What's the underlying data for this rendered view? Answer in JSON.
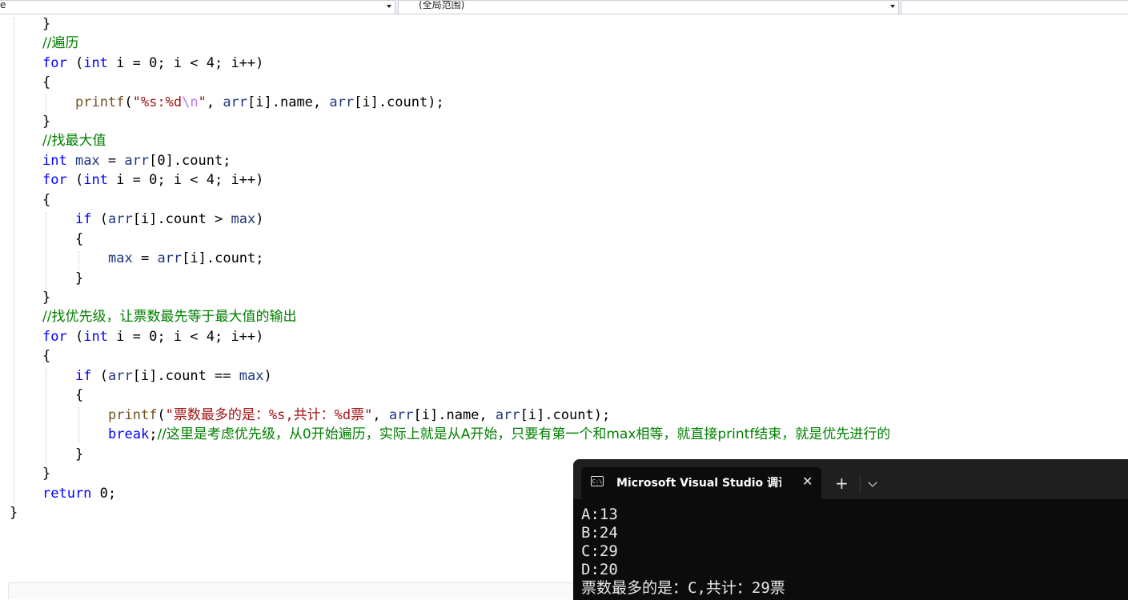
{
  "navbar": {
    "left_combo": "e",
    "right_combo": "(全局范围)"
  },
  "code": {
    "l01": "}",
    "l02_comment": "//遍历",
    "for_kw": "for",
    "int_kw": "int",
    "loop_rest_a": " i = 0; i < 4; i++)",
    "open_brace": "{",
    "close_brace": "}",
    "printf_fn": "printf",
    "l05_str": "\"%s:%d",
    "l05_esc": "\\n",
    "l05_strend": "\"",
    "l05_args_a": ", ",
    "arr": "arr",
    "l05_args_b": "[i].name, ",
    "l05_args_c": "[i].count);",
    "l07_comment": "//找最大值",
    "l08_var": " max",
    "l08_rest": " = ",
    "l08_tail": "[0].count;",
    "if_kw": "if",
    "l11_a": " (",
    "l11_b": "[i].count > ",
    "max": "max",
    "l11_c": ")",
    "l13_a": " = ",
    "l13_b": "[i].count;",
    "l16_comment": "//找优先级，让票数最先等于最大值的输出",
    "l19_b": "[i].count == ",
    "l21_str": "\"票数最多的是：%s,共计：%d票\"",
    "break_kw": "break",
    "l22_semi": ";",
    "l22_comment": "//这里是考虑优先级，从0开始遍历，实际上就是从A开始，只要有第一个和max相等，就直接printf结束，就是优先进行的",
    "return_kw": "return",
    "l25_rest": " 0;"
  },
  "terminal": {
    "tab_title": "Microsoft Visual Studio 调试控制台",
    "tab_icon_text": "C:\\",
    "close_glyph": "✕",
    "new_tab_glyph": "+",
    "output": [
      "A:13",
      "B:24",
      "C:29",
      "D:20",
      "票数最多的是：C,共计：29票"
    ]
  }
}
